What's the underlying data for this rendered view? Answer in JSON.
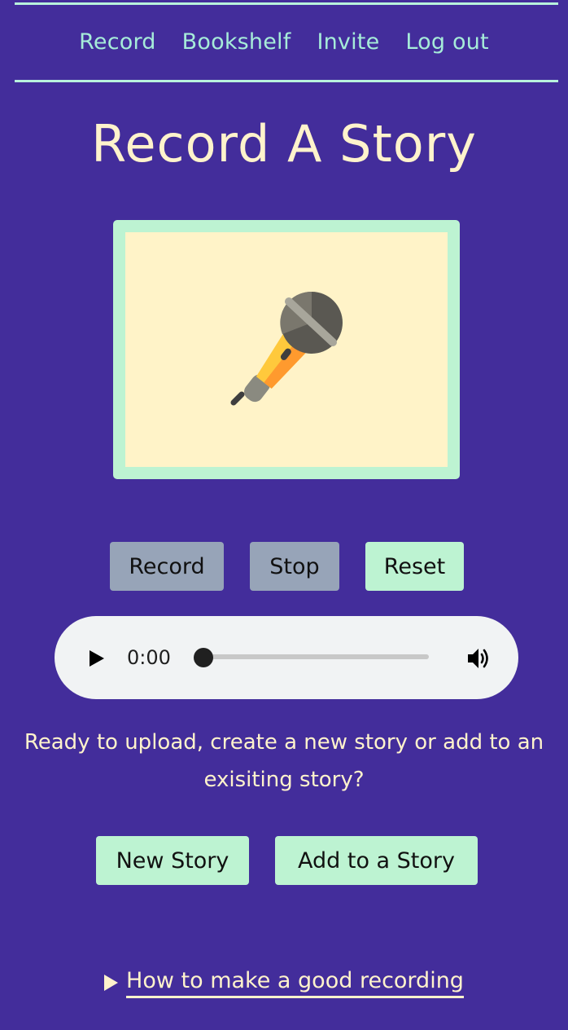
{
  "nav": {
    "items": [
      {
        "label": "Record"
      },
      {
        "label": "Bookshelf"
      },
      {
        "label": "Invite"
      },
      {
        "label": "Log out"
      }
    ]
  },
  "page": {
    "title": "Record A Story"
  },
  "preview": {
    "icon": "microphone-icon"
  },
  "controls": {
    "record_label": "Record",
    "stop_label": "Stop",
    "reset_label": "Reset"
  },
  "player": {
    "current_time": "0:00",
    "progress": 0
  },
  "upload": {
    "prompt": "Ready to upload, create a new story or add to an exisiting story?",
    "new_story_label": "New Story",
    "add_story_label": "Add to a Story"
  },
  "help": {
    "summary": "How to make a good recording"
  },
  "colors": {
    "background": "#432d9b",
    "accent": "#bdf3d2",
    "nav_text": "#a6ecd9",
    "cream": "#fff3cc",
    "disabled_button": "#97a4b8"
  }
}
